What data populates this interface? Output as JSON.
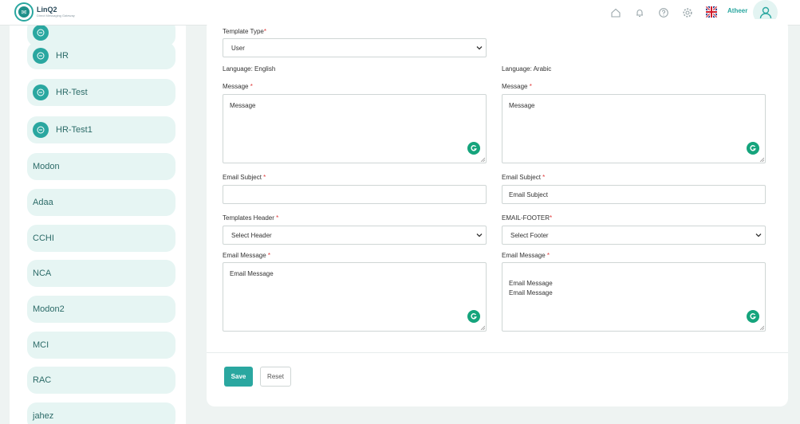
{
  "app": {
    "logo_name": "LinQ2",
    "logo_tagline": "Direct Messaging Gateway",
    "user_name": "Atheer"
  },
  "header_icons": [
    "home-icon",
    "bell-icon",
    "help-icon",
    "gear-icon"
  ],
  "colors": {
    "accent": "#2aa7a0",
    "sidebar_item_bg": "#e6f5f3",
    "required": "#e03a3a",
    "grammarly": "#15a47c"
  },
  "sidebar": {
    "items": [
      {
        "label": "",
        "icon": "minus-circle-icon"
      },
      {
        "label": "HR",
        "icon": "minus-circle-icon"
      },
      {
        "label": "HR-Test",
        "icon": "minus-circle-icon"
      },
      {
        "label": "HR-Test1",
        "icon": "minus-circle-icon"
      },
      {
        "label": "Modon"
      },
      {
        "label": "Adaa"
      },
      {
        "label": "CCHI"
      },
      {
        "label": "NCA"
      },
      {
        "label": "Modon2"
      },
      {
        "label": "MCI"
      },
      {
        "label": "RAC"
      },
      {
        "label": "jahez"
      }
    ]
  },
  "form": {
    "template_type": {
      "label": "Template Type",
      "value": "User"
    },
    "english": {
      "language_label": "Language: English",
      "message_label": "Message",
      "message_placeholder": "Message",
      "subject_label": "Email Subject",
      "subject_value": "",
      "header_label": "Templates Header",
      "header_value": "Select Header",
      "email_message_label": "Email Message",
      "email_message_value": "Email Message"
    },
    "arabic": {
      "language_label": "Language: Arabic",
      "message_label": "Message",
      "message_placeholder": "Message",
      "subject_label": "Email Subject",
      "subject_value": "Email Subject",
      "footer_label": "EMAIL-FOOTER",
      "footer_value": "Select Footer",
      "email_message_label": "Email Message",
      "email_message_line1": "Email Message",
      "email_message_line2": "Email Message"
    },
    "required_mark": "*",
    "save_label": "Save",
    "reset_label": "Reset"
  }
}
